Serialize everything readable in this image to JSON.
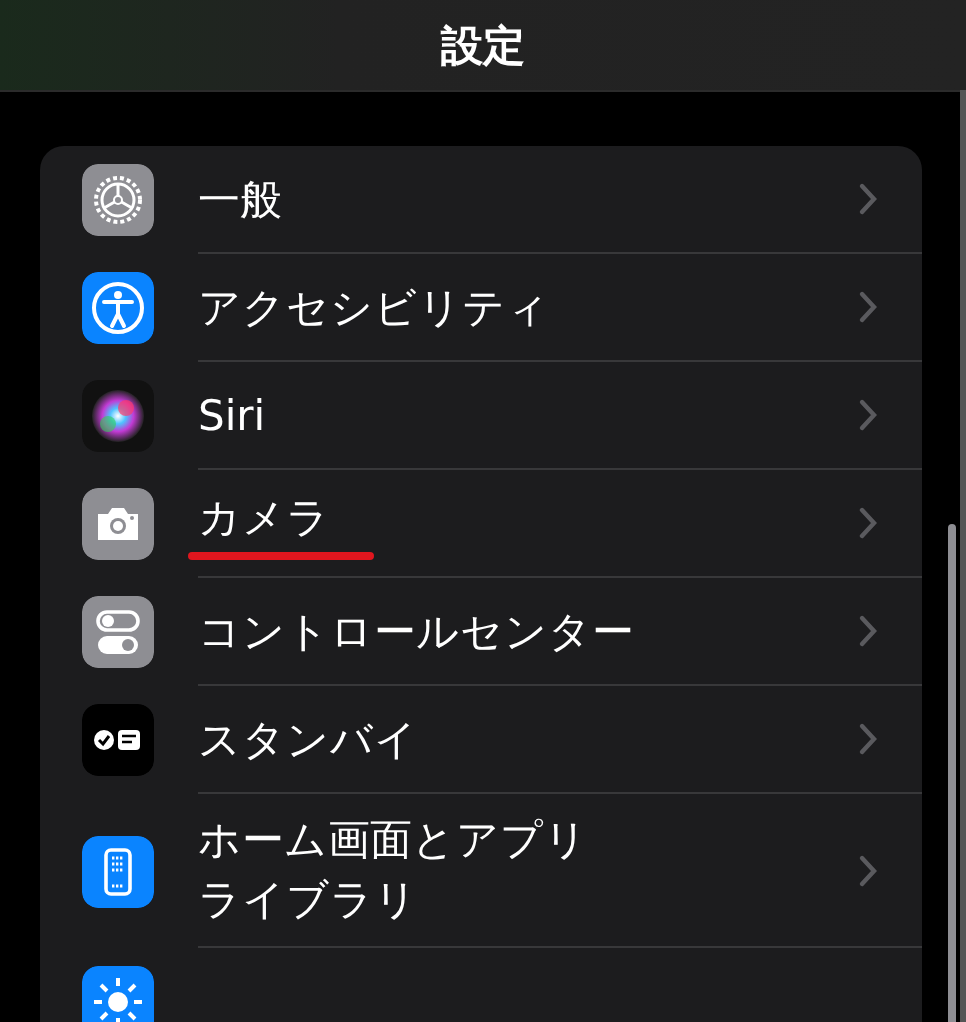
{
  "header": {
    "title": "設定"
  },
  "items": [
    {
      "kind": "gear",
      "label": "一般",
      "underlined": false
    },
    {
      "kind": "accessibility",
      "label": "アクセシビリティ",
      "underlined": false
    },
    {
      "kind": "siri",
      "label": "Siri",
      "underlined": false
    },
    {
      "kind": "camera",
      "label": "カメラ",
      "underlined": true
    },
    {
      "kind": "toggles",
      "label": "コントロールセンター",
      "underlined": false
    },
    {
      "kind": "standby",
      "label": "スタンバイ",
      "underlined": false
    },
    {
      "kind": "homescreen",
      "label_lines": [
        "ホーム画面とアプリ",
        "ライブラリ"
      ],
      "underlined": false
    },
    {
      "kind": "sun"
    }
  ]
}
